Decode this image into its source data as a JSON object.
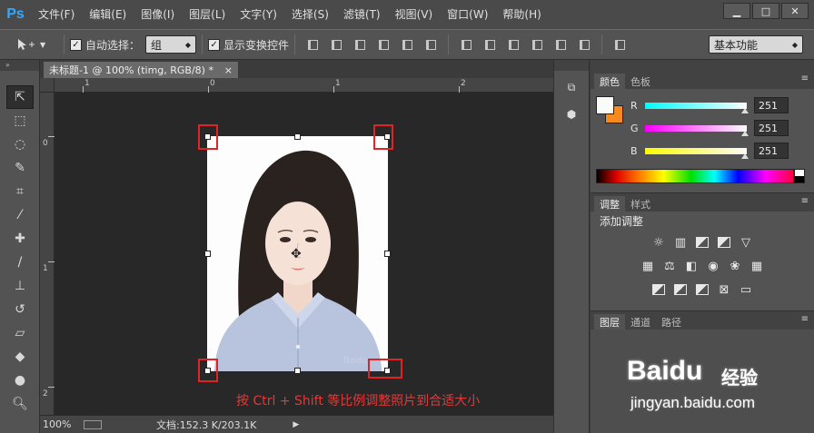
{
  "app": {
    "logo": "Ps"
  },
  "menu": [
    "文件(F)",
    "编辑(E)",
    "图像(I)",
    "图层(L)",
    "文字(Y)",
    "选择(S)",
    "滤镜(T)",
    "视图(V)",
    "窗口(W)",
    "帮助(H)"
  ],
  "window_buttons": [
    "▁",
    "□",
    "✕"
  ],
  "options": {
    "auto_select_label": "自动选择：",
    "auto_select_checked": true,
    "group_value": "组",
    "show_transform_label": "显示变换控件",
    "show_transform_checked": true,
    "workspace_value": "基本功能"
  },
  "document": {
    "tab_title": "未标题-1 @ 100% (timg, RGB/8) *",
    "tab_close": "×",
    "ruler_h_labels": [
      "1",
      "0",
      "1",
      "2"
    ],
    "ruler_v_labels": [
      "0",
      "1",
      "2"
    ],
    "photo_watermark": "Baidu"
  },
  "caption": "按 Ctrl + Shift  等比例调整照片到合适大小",
  "status": {
    "zoom": "100%",
    "doc_info": "文档:152.3 K/203.1K"
  },
  "color_panel": {
    "tabs": [
      "颜色",
      "色板"
    ],
    "fg_color": "#fbfbfb",
    "bg_color": "#f58b1f",
    "channels": [
      {
        "label": "R",
        "value": "251"
      },
      {
        "label": "G",
        "value": "251"
      },
      {
        "label": "B",
        "value": "251"
      }
    ]
  },
  "adjust_panel": {
    "tabs": [
      "调整",
      "样式"
    ],
    "title": "添加调整"
  },
  "layers_panel": {
    "tabs": [
      "图层",
      "通道",
      "路径"
    ]
  },
  "watermark": {
    "brand": "Baidu",
    "brand_cn": "经验",
    "url": "jingyan.baidu.com"
  }
}
